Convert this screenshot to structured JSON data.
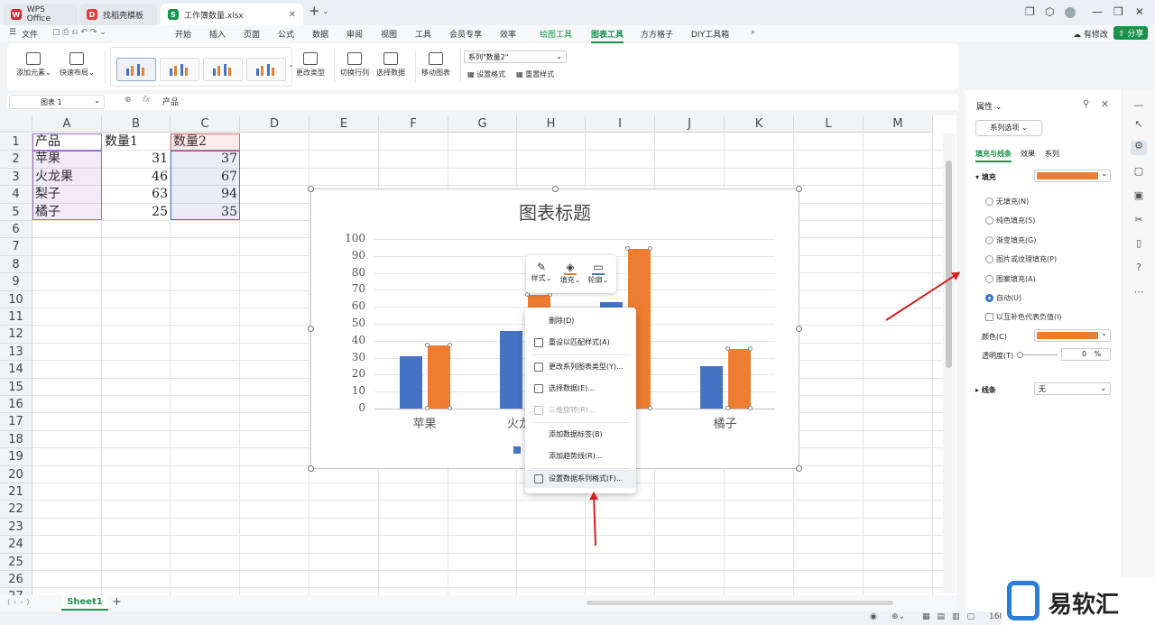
{
  "tabs": [
    {
      "label": "WPS Office",
      "logo": "W",
      "color": "#d0282e"
    },
    {
      "label": "找稻壳模板",
      "logo": "D",
      "color": "#e03c3c"
    },
    {
      "label": "工作簿数量.xlsx",
      "logo": "S",
      "color": "#17934c"
    }
  ],
  "menu": {
    "file": "文件",
    "items": [
      "开始",
      "插入",
      "页面",
      "公式",
      "数据",
      "审阅",
      "视图",
      "工具",
      "会员专享",
      "效率",
      "绘图工具",
      "图表工具",
      "方方格子",
      "DIY工具箱"
    ],
    "edit_status": "有修改",
    "share": "分享"
  },
  "ribbon": {
    "add_element": "添加元素",
    "quick_layout": "快速布局",
    "change_type": "更改类型",
    "switch_row_col": "切换行列",
    "select_data": "选择数据",
    "move_chart": "移动图表",
    "series_select": "系列\"数量2\"",
    "set_format": "设置格式",
    "reset_style": "重置样式"
  },
  "formula": {
    "namebox": "图表 1",
    "fx": "fx",
    "value": "产品"
  },
  "columns": [
    "A",
    "B",
    "C",
    "D",
    "E",
    "F",
    "G",
    "H",
    "I",
    "J",
    "K",
    "L",
    "M"
  ],
  "rows": [
    "1",
    "2",
    "3",
    "4",
    "5",
    "6",
    "7",
    "8",
    "9",
    "10",
    "11",
    "12",
    "13",
    "14",
    "15",
    "16",
    "17",
    "18",
    "19",
    "20",
    "21",
    "22",
    "23",
    "24",
    "25",
    "26",
    "27"
  ],
  "table": {
    "headers": [
      "产品",
      "数量1",
      "数量2"
    ],
    "rows": [
      [
        "苹果",
        "31",
        "37"
      ],
      [
        "火龙果",
        "46",
        "67"
      ],
      [
        "梨子",
        "63",
        "94"
      ],
      [
        "橘子",
        "25",
        "35"
      ]
    ]
  },
  "chart_data": {
    "type": "bar",
    "title": "图表标题",
    "categories": [
      "苹果",
      "火龙果",
      "梨子",
      "橘子"
    ],
    "series": [
      {
        "values": [
          31,
          46,
          63,
          25
        ],
        "color": "#4472c4"
      },
      {
        "values": [
          37,
          67,
          94,
          35
        ],
        "color": "#ed7d31"
      }
    ],
    "ylim": [
      0,
      100
    ],
    "yticks": [
      "0",
      "10",
      "20",
      "30",
      "40",
      "50",
      "60",
      "70",
      "80",
      "90",
      "100"
    ],
    "grid": true
  },
  "mini_toolbar": {
    "style": "样式",
    "fill": "填充",
    "outline": "轮廓"
  },
  "context_menu": [
    {
      "label": "删除(D)",
      "disabled": false
    },
    {
      "label": "重设以匹配样式(A)",
      "disabled": false
    },
    {
      "label": "更改系列图表类型(Y)...",
      "disabled": false
    },
    {
      "label": "选择数据(E)...",
      "disabled": false
    },
    {
      "label": "三维旋转(R)...",
      "disabled": true
    },
    {
      "label": "添加数据标签(B)",
      "disabled": false
    },
    {
      "label": "添加趋势线(R)...",
      "disabled": false
    },
    {
      "label": "设置数据系列格式(F)...",
      "disabled": false
    }
  ],
  "panel": {
    "title": "属性",
    "series_options": "系列选项",
    "tabs": [
      "填充与线条",
      "效果",
      "系列"
    ],
    "fill_label": "填充",
    "fill_color": "#ed7d31",
    "fill_options": [
      "无填充(N)",
      "纯色填充(S)",
      "渐变填充(G)",
      "图片或纹理填充(P)",
      "图案填充(A)",
      "自动(U)"
    ],
    "invert_if_negative": "以互补色代表负值(I)",
    "color_label": "颜色(C)",
    "transparency_label": "透明度(T)",
    "transparency_value": "0",
    "percent": "%",
    "line_label": "线条",
    "line_value": "无"
  },
  "sheet": {
    "name": "Sheet1",
    "add": "+"
  },
  "status": {
    "zoom": "160"
  },
  "watermark": "易软汇"
}
